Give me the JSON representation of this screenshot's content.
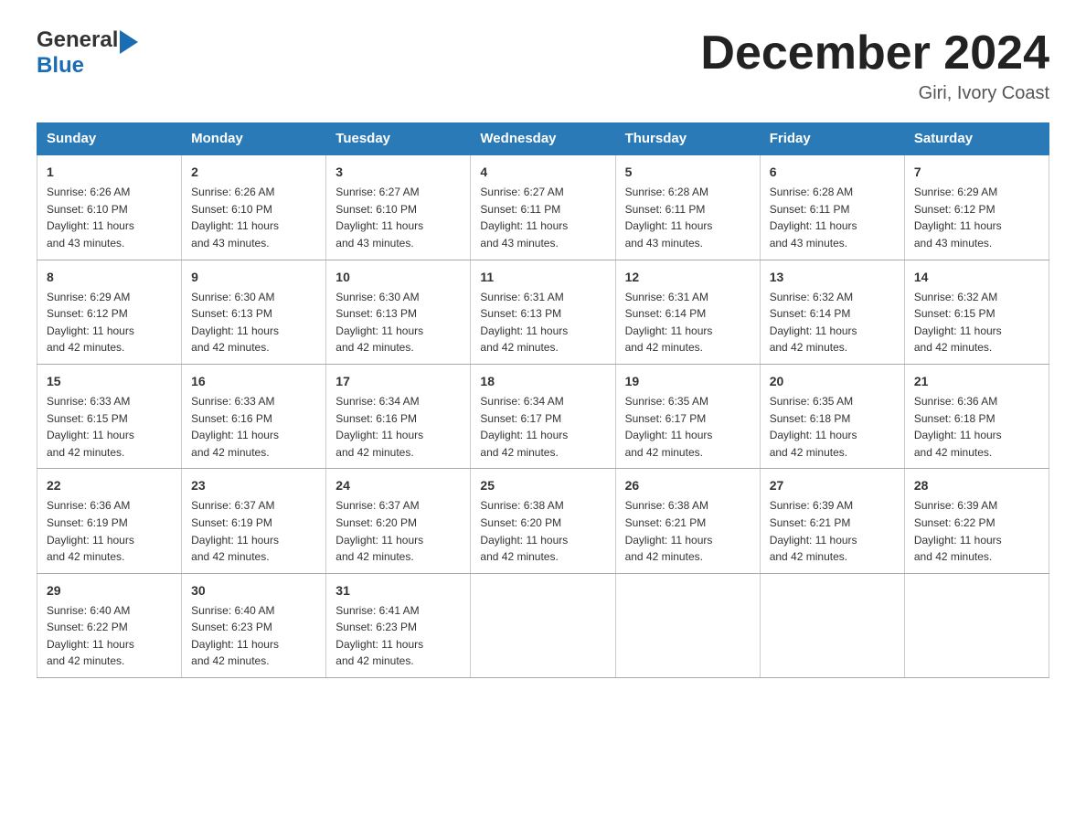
{
  "header": {
    "logo_general": "General",
    "logo_blue": "Blue",
    "month_title": "December 2024",
    "location": "Giri, Ivory Coast"
  },
  "days_of_week": [
    "Sunday",
    "Monday",
    "Tuesday",
    "Wednesday",
    "Thursday",
    "Friday",
    "Saturday"
  ],
  "weeks": [
    [
      {
        "day": 1,
        "sunrise": "6:26 AM",
        "sunset": "6:10 PM",
        "daylight": "11 hours and 43 minutes."
      },
      {
        "day": 2,
        "sunrise": "6:26 AM",
        "sunset": "6:10 PM",
        "daylight": "11 hours and 43 minutes."
      },
      {
        "day": 3,
        "sunrise": "6:27 AM",
        "sunset": "6:10 PM",
        "daylight": "11 hours and 43 minutes."
      },
      {
        "day": 4,
        "sunrise": "6:27 AM",
        "sunset": "6:11 PM",
        "daylight": "11 hours and 43 minutes."
      },
      {
        "day": 5,
        "sunrise": "6:28 AM",
        "sunset": "6:11 PM",
        "daylight": "11 hours and 43 minutes."
      },
      {
        "day": 6,
        "sunrise": "6:28 AM",
        "sunset": "6:11 PM",
        "daylight": "11 hours and 43 minutes."
      },
      {
        "day": 7,
        "sunrise": "6:29 AM",
        "sunset": "6:12 PM",
        "daylight": "11 hours and 43 minutes."
      }
    ],
    [
      {
        "day": 8,
        "sunrise": "6:29 AM",
        "sunset": "6:12 PM",
        "daylight": "11 hours and 42 minutes."
      },
      {
        "day": 9,
        "sunrise": "6:30 AM",
        "sunset": "6:13 PM",
        "daylight": "11 hours and 42 minutes."
      },
      {
        "day": 10,
        "sunrise": "6:30 AM",
        "sunset": "6:13 PM",
        "daylight": "11 hours and 42 minutes."
      },
      {
        "day": 11,
        "sunrise": "6:31 AM",
        "sunset": "6:13 PM",
        "daylight": "11 hours and 42 minutes."
      },
      {
        "day": 12,
        "sunrise": "6:31 AM",
        "sunset": "6:14 PM",
        "daylight": "11 hours and 42 minutes."
      },
      {
        "day": 13,
        "sunrise": "6:32 AM",
        "sunset": "6:14 PM",
        "daylight": "11 hours and 42 minutes."
      },
      {
        "day": 14,
        "sunrise": "6:32 AM",
        "sunset": "6:15 PM",
        "daylight": "11 hours and 42 minutes."
      }
    ],
    [
      {
        "day": 15,
        "sunrise": "6:33 AM",
        "sunset": "6:15 PM",
        "daylight": "11 hours and 42 minutes."
      },
      {
        "day": 16,
        "sunrise": "6:33 AM",
        "sunset": "6:16 PM",
        "daylight": "11 hours and 42 minutes."
      },
      {
        "day": 17,
        "sunrise": "6:34 AM",
        "sunset": "6:16 PM",
        "daylight": "11 hours and 42 minutes."
      },
      {
        "day": 18,
        "sunrise": "6:34 AM",
        "sunset": "6:17 PM",
        "daylight": "11 hours and 42 minutes."
      },
      {
        "day": 19,
        "sunrise": "6:35 AM",
        "sunset": "6:17 PM",
        "daylight": "11 hours and 42 minutes."
      },
      {
        "day": 20,
        "sunrise": "6:35 AM",
        "sunset": "6:18 PM",
        "daylight": "11 hours and 42 minutes."
      },
      {
        "day": 21,
        "sunrise": "6:36 AM",
        "sunset": "6:18 PM",
        "daylight": "11 hours and 42 minutes."
      }
    ],
    [
      {
        "day": 22,
        "sunrise": "6:36 AM",
        "sunset": "6:19 PM",
        "daylight": "11 hours and 42 minutes."
      },
      {
        "day": 23,
        "sunrise": "6:37 AM",
        "sunset": "6:19 PM",
        "daylight": "11 hours and 42 minutes."
      },
      {
        "day": 24,
        "sunrise": "6:37 AM",
        "sunset": "6:20 PM",
        "daylight": "11 hours and 42 minutes."
      },
      {
        "day": 25,
        "sunrise": "6:38 AM",
        "sunset": "6:20 PM",
        "daylight": "11 hours and 42 minutes."
      },
      {
        "day": 26,
        "sunrise": "6:38 AM",
        "sunset": "6:21 PM",
        "daylight": "11 hours and 42 minutes."
      },
      {
        "day": 27,
        "sunrise": "6:39 AM",
        "sunset": "6:21 PM",
        "daylight": "11 hours and 42 minutes."
      },
      {
        "day": 28,
        "sunrise": "6:39 AM",
        "sunset": "6:22 PM",
        "daylight": "11 hours and 42 minutes."
      }
    ],
    [
      {
        "day": 29,
        "sunrise": "6:40 AM",
        "sunset": "6:22 PM",
        "daylight": "11 hours and 42 minutes."
      },
      {
        "day": 30,
        "sunrise": "6:40 AM",
        "sunset": "6:23 PM",
        "daylight": "11 hours and 42 minutes."
      },
      {
        "day": 31,
        "sunrise": "6:41 AM",
        "sunset": "6:23 PM",
        "daylight": "11 hours and 42 minutes."
      },
      null,
      null,
      null,
      null
    ]
  ],
  "labels": {
    "sunrise": "Sunrise:",
    "sunset": "Sunset:",
    "daylight": "Daylight:"
  }
}
